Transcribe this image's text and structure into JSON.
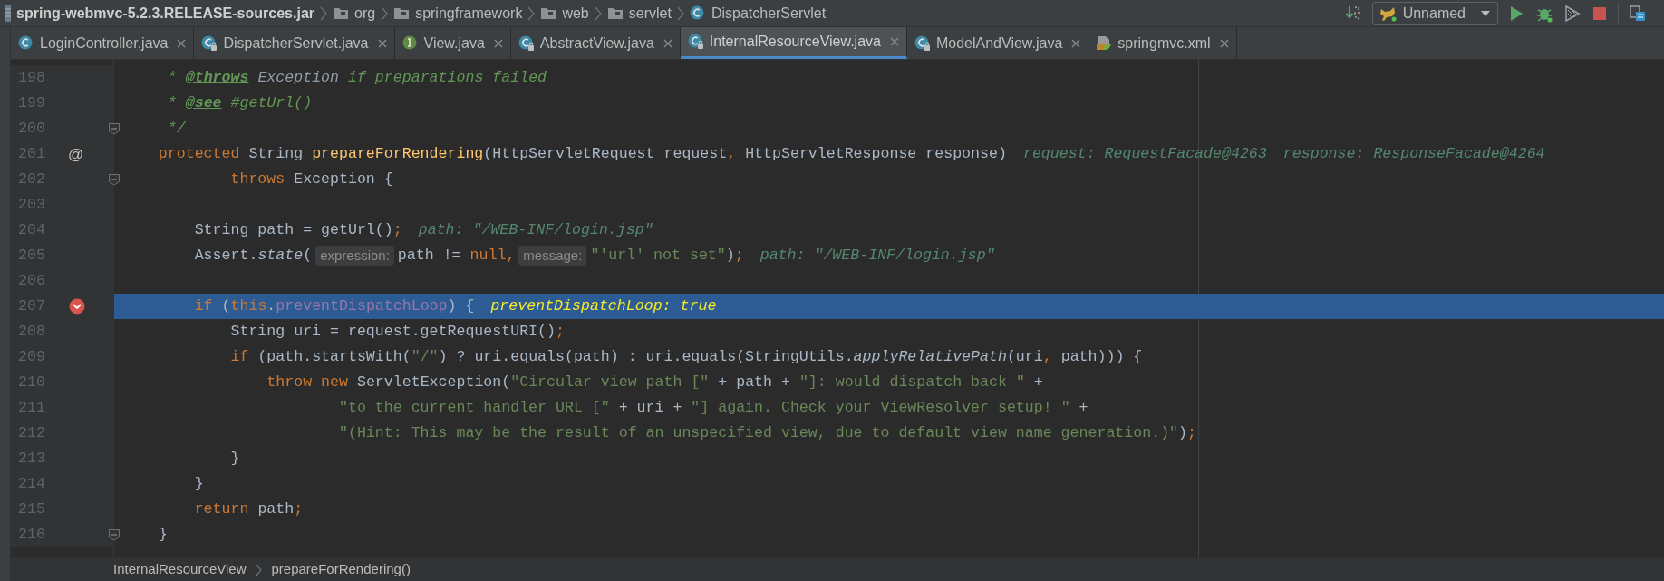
{
  "breadcrumb": [
    {
      "kind": "jar",
      "label": "spring-webmvc-5.2.3.RELEASE-sources.jar"
    },
    {
      "kind": "folder",
      "label": "org"
    },
    {
      "kind": "folder",
      "label": "springframework"
    },
    {
      "kind": "folder",
      "label": "web"
    },
    {
      "kind": "folder",
      "label": "servlet"
    },
    {
      "kind": "class",
      "label": "DispatcherServlet"
    }
  ],
  "run_config": {
    "label": "Unnamed"
  },
  "tabs": [
    {
      "label": "LoginController.java",
      "kind": "class",
      "locked": false,
      "selected": false
    },
    {
      "label": "DispatcherServlet.java",
      "kind": "class",
      "locked": true,
      "selected": false
    },
    {
      "label": "View.java",
      "kind": "interface",
      "locked": false,
      "selected": false
    },
    {
      "label": "AbstractView.java",
      "kind": "class",
      "locked": true,
      "selected": false
    },
    {
      "label": "InternalResourceView.java",
      "kind": "class",
      "locked": true,
      "selected": true
    },
    {
      "label": "ModelAndView.java",
      "kind": "class",
      "locked": true,
      "selected": false
    },
    {
      "label": "springmvc.xml",
      "kind": "xml",
      "locked": false,
      "selected": false
    }
  ],
  "editor": {
    "lines": [
      {
        "number": "198",
        "kind": "plain",
        "highlighted": false,
        "tokens": [
          {
            "kind": "comment",
            "text": "     * "
          },
          {
            "kind": "doctag",
            "text": "@throws"
          },
          {
            "kind": "docref",
            "text": " Exception"
          },
          {
            "kind": "comment",
            "text": " if preparations failed"
          }
        ]
      },
      {
        "number": "199",
        "kind": "plain",
        "highlighted": false,
        "tokens": [
          {
            "kind": "comment",
            "text": "     * "
          },
          {
            "kind": "doctag",
            "text": "@see"
          },
          {
            "kind": "comment",
            "text": " #getUrl()"
          }
        ]
      },
      {
        "number": "200",
        "kind": "fold",
        "highlighted": false,
        "tokens": [
          {
            "kind": "comment",
            "text": "     */"
          }
        ]
      },
      {
        "number": "201",
        "kind": "mark",
        "mark": "@",
        "highlighted": false,
        "tokens": [
          {
            "kind": "keyword",
            "text": "    protected"
          },
          {
            "kind": "plain",
            "text": " String "
          },
          {
            "kind": "method",
            "text": "prepareForRendering"
          },
          {
            "kind": "plain",
            "text": "(HttpServletRequest request"
          },
          {
            "kind": "punct",
            "text": ","
          },
          {
            "kind": "plain",
            "text": " HttpServletResponse response)"
          },
          {
            "kind": "debug",
            "text": "request: RequestFacade@4263"
          },
          {
            "kind": "debug",
            "text": "response: ResponseFacade@4264"
          }
        ]
      },
      {
        "number": "202",
        "kind": "fold",
        "highlighted": false,
        "tokens": [
          {
            "kind": "keyword",
            "text": "            throws"
          },
          {
            "kind": "plain",
            "text": " Exception {"
          }
        ]
      },
      {
        "number": "203",
        "kind": "plain",
        "highlighted": false
      },
      {
        "number": "204",
        "kind": "plain",
        "highlighted": false,
        "tokens": [
          {
            "kind": "plain",
            "text": "        String path = getUrl()"
          },
          {
            "kind": "punct",
            "text": ";"
          },
          {
            "kind": "debug",
            "text": "path: \"/WEB-INF/login.jsp\""
          }
        ]
      },
      {
        "number": "205",
        "kind": "plain",
        "highlighted": false,
        "tokens": [
          {
            "kind": "plain",
            "text": "        Assert."
          },
          {
            "kind": "static",
            "text": "state"
          },
          {
            "kind": "plain",
            "text": "("
          },
          {
            "kind": "hint",
            "text": "expression:"
          },
          {
            "kind": "plain",
            "text": "path != "
          },
          {
            "kind": "keyword",
            "text": "null"
          },
          {
            "kind": "punct",
            "text": ","
          },
          {
            "kind": "hint",
            "text": "message:"
          },
          {
            "kind": "string",
            "text": "\"'url' not set\""
          },
          {
            "kind": "plain",
            "text": ")"
          },
          {
            "kind": "punct",
            "text": ";"
          },
          {
            "kind": "debug",
            "text": "path: \"/WEB-INF/login.jsp\""
          }
        ]
      },
      {
        "number": "206",
        "kind": "plain",
        "highlighted": false
      },
      {
        "number": "207",
        "kind": "breakpoint",
        "highlighted": true,
        "tokens": [
          {
            "kind": "keyword",
            "text": "        if"
          },
          {
            "kind": "plain",
            "text": " ("
          },
          {
            "kind": "keyword",
            "text": "this"
          },
          {
            "kind": "plain",
            "text": "."
          },
          {
            "kind": "field",
            "text": "preventDispatchLoop"
          },
          {
            "kind": "plain",
            "text": ") {"
          },
          {
            "kind": "debug_current",
            "text": "preventDispatchLoop: true"
          }
        ]
      },
      {
        "number": "208",
        "kind": "plain",
        "highlighted": false,
        "tokens": [
          {
            "kind": "plain",
            "text": "            String uri = request.getRequestURI()"
          },
          {
            "kind": "punct",
            "text": ";"
          }
        ]
      },
      {
        "number": "209",
        "kind": "plain",
        "highlighted": false,
        "tokens": [
          {
            "kind": "keyword",
            "text": "            if"
          },
          {
            "kind": "plain",
            "text": " (path.startsWith("
          },
          {
            "kind": "string",
            "text": "\"/\""
          },
          {
            "kind": "plain",
            "text": ") ? uri.equals(path) : uri.equals(StringUtils."
          },
          {
            "kind": "static",
            "text": "applyRelativePath"
          },
          {
            "kind": "plain",
            "text": "(uri"
          },
          {
            "kind": "punct",
            "text": ","
          },
          {
            "kind": "plain",
            "text": " path))) {"
          }
        ]
      },
      {
        "number": "210",
        "kind": "plain",
        "highlighted": false,
        "tokens": [
          {
            "kind": "keyword",
            "text": "                throw"
          },
          {
            "kind": "keyword",
            "text": " new"
          },
          {
            "kind": "plain",
            "text": " ServletException("
          },
          {
            "kind": "string",
            "text": "\"Circular view path [\""
          },
          {
            "kind": "plain",
            "text": " + path + "
          },
          {
            "kind": "string",
            "text": "\"]: would dispatch back \""
          },
          {
            "kind": "plain",
            "text": " +"
          }
        ]
      },
      {
        "number": "211",
        "kind": "plain",
        "highlighted": false,
        "tokens": [
          {
            "kind": "string",
            "text": "                        \"to the current handler URL [\""
          },
          {
            "kind": "plain",
            "text": " + uri + "
          },
          {
            "kind": "string",
            "text": "\"] again. Check your ViewResolver setup! \""
          },
          {
            "kind": "plain",
            "text": " +"
          }
        ]
      },
      {
        "number": "212",
        "kind": "plain",
        "highlighted": false,
        "tokens": [
          {
            "kind": "string",
            "text": "                        \"(Hint: This may be the result of an unspecified view, due to default view name generation.)\""
          },
          {
            "kind": "plain",
            "text": ")"
          },
          {
            "kind": "punct",
            "text": ";"
          }
        ]
      },
      {
        "number": "213",
        "kind": "plain",
        "highlighted": false,
        "tokens": [
          {
            "kind": "plain",
            "text": "            }"
          }
        ]
      },
      {
        "number": "214",
        "kind": "plain",
        "highlighted": false,
        "tokens": [
          {
            "kind": "plain",
            "text": "        }"
          }
        ]
      },
      {
        "number": "215",
        "kind": "plain",
        "highlighted": false,
        "tokens": [
          {
            "kind": "keyword",
            "text": "        return"
          },
          {
            "kind": "plain",
            "text": " path"
          },
          {
            "kind": "punct",
            "text": ";"
          }
        ]
      },
      {
        "number": "216",
        "kind": "fold",
        "highlighted": false,
        "tokens": [
          {
            "kind": "plain",
            "text": "    }"
          }
        ]
      }
    ]
  },
  "status_breadcrumb": [
    "InternalResourceView",
    "prepareForRendering()"
  ]
}
